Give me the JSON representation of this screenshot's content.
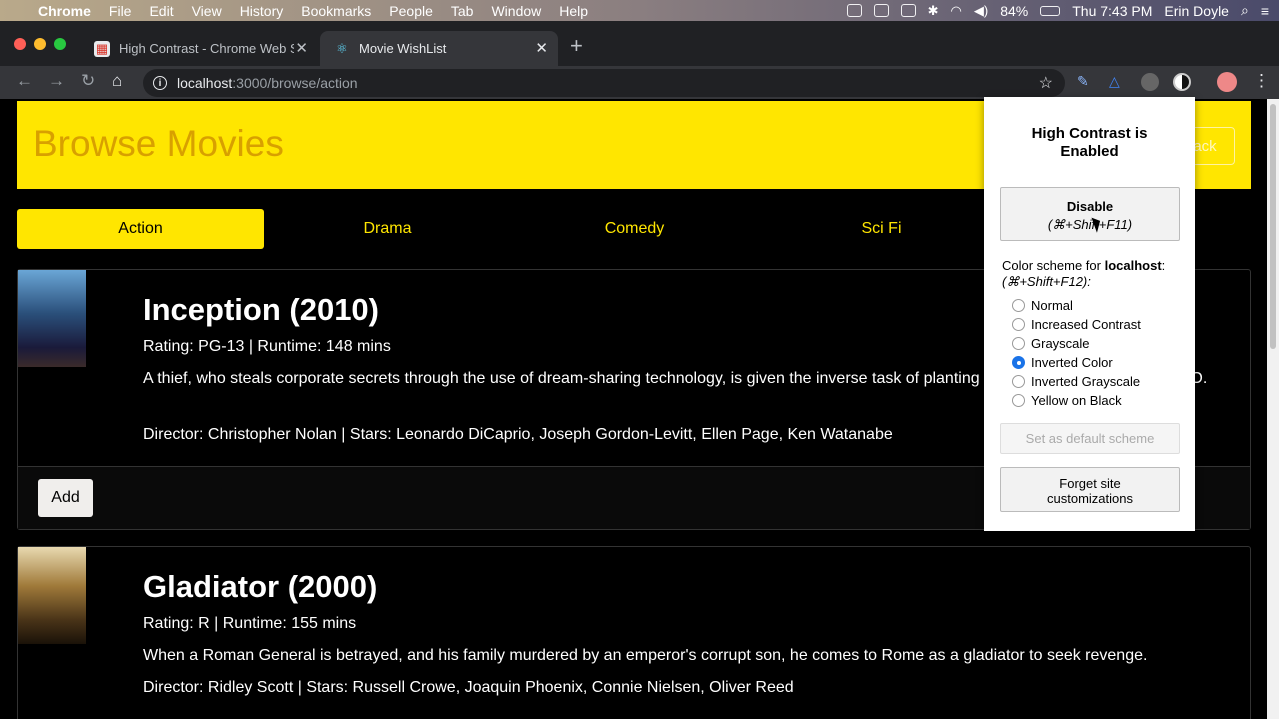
{
  "menubar": {
    "app": "Chrome",
    "items": [
      "File",
      "Edit",
      "View",
      "History",
      "Bookmarks",
      "People",
      "Tab",
      "Window",
      "Help"
    ],
    "battery": "84%",
    "clock": "Thu 7:43 PM",
    "user": "Erin Doyle"
  },
  "tabs": [
    {
      "title": "High Contrast - Chrome Web S",
      "icon": "chrome-web-store-icon"
    },
    {
      "title": "Movie WishList",
      "icon": "react-icon"
    }
  ],
  "omnibox": {
    "host": "localhost",
    "path": ":3000/browse/action"
  },
  "page": {
    "heading": "Browse Movies",
    "back_label": "Back",
    "categories": [
      "Action",
      "Drama",
      "Comedy",
      "Sci Fi"
    ],
    "add_label": "Add",
    "movies": [
      {
        "title": "Inception (2010)",
        "meta": "Rating: PG-13 | Runtime: 148 mins",
        "desc": "A thief, who steals corporate secrets through the use of dream-sharing technology, is given the inverse task of planting an idea into the mind of a CEO.",
        "credits": "Director: Christopher Nolan | Stars: Leonardo DiCaprio, Joseph Gordon-Levitt, Ellen Page, Ken Watanabe"
      },
      {
        "title": "Gladiator (2000)",
        "meta": "Rating: R | Runtime: 155 mins",
        "desc": "When a Roman General is betrayed, and his family murdered by an emperor's corrupt son, he comes to Rome as a gladiator to seek revenge.",
        "credits": "Director: Ridley Scott | Stars: Russell Crowe, Joaquin Phoenix, Connie Nielsen, Oliver Reed"
      }
    ]
  },
  "popup": {
    "title": "High Contrast is Enabled",
    "disable_label": "Disable",
    "disable_shortcut": "(⌘+Shift+F11)",
    "scheme_label_prefix": "Color scheme for ",
    "scheme_host": "localhost",
    "scheme_label_suffix": ":",
    "scheme_shortcut": "(⌘+Shift+F12):",
    "schemes": [
      "Normal",
      "Increased Contrast",
      "Grayscale",
      "Inverted Color",
      "Inverted Grayscale",
      "Yellow on Black"
    ],
    "selected_scheme": "Inverted Color",
    "default_label": "Set as default scheme",
    "forget_label": "Forget site customizations"
  },
  "colors": {
    "header_bg": "#ffe600",
    "accent": "#ffe600",
    "radio_selected": "#1a73e8"
  }
}
